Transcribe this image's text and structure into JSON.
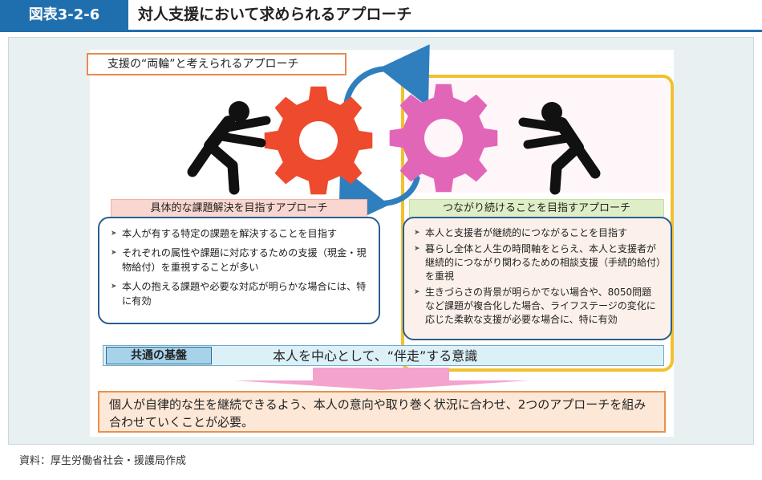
{
  "header": {
    "figure_label": "図表3-2-6",
    "title": "対人支援において求められるアプローチ"
  },
  "diagram": {
    "top_tag": "支援の“両輪”と考えられるアプローチ",
    "left": {
      "label": "具体的な課題解決を目指すアプローチ",
      "items": [
        "本人が有する特定の課題を解決することを目指す",
        "それぞれの属性や課題に対応するための支援（現金・現物給付）を重視することが多い",
        "本人の抱える課題や必要な対応が明らかな場合には、特に有効"
      ],
      "gear_color": "#ee4a2e"
    },
    "right": {
      "label": "つながり続けることを目指すアプローチ",
      "items": [
        "本人と支援者が継続的につながることを目指す",
        "暮らし全体と人生の時間軸をとらえ、本人と支援者が継続的につながり関わるための相談支援（手続的給付）を重視",
        "生きづらさの背景が明らかでない場合や、8050問題など課題が複合化した場合、ライフステージの変化に応じた柔軟な支援が必要な場合に、特に有効"
      ],
      "gear_color": "#e266b8"
    },
    "common": {
      "label": "共通の基盤",
      "text": "本人を中心として、“伴走”する意識"
    },
    "conclusion": "個人が自律的な生を継続できるよう、本人の意向や取り巻く状況に合わせ、2つのアプローチを組み合わせていくことが必要。",
    "colors": {
      "accent_blue": "#1f6fae",
      "frame_yellow": "#f2c12e",
      "arrow_blue": "#2f7fbf",
      "down_arrow_pink": "#f4a3cf"
    }
  },
  "source": "資料：厚生労働省社会・援護局作成"
}
